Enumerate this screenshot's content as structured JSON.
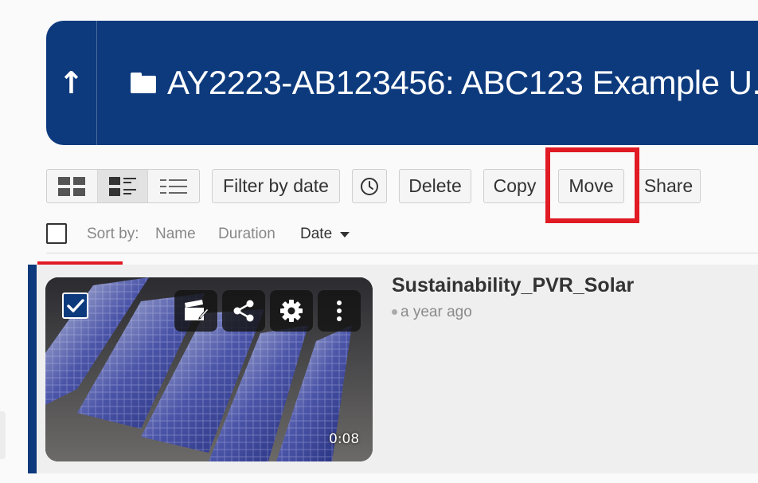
{
  "header": {
    "up_icon": "arrow-up-icon",
    "up_glyph": "↑",
    "folder_icon": "folder-icon",
    "title": "AY2223-AB123456: ABC123 Example U..."
  },
  "toolbar": {
    "view_modes": [
      "grid-view-icon",
      "detail-view-icon",
      "list-view-icon"
    ],
    "filter_label": "Filter by date",
    "clock_icon": "clock-icon",
    "delete_label": "Delete",
    "copy_label": "Copy",
    "move_label": "Move",
    "share_label": "Share"
  },
  "sort": {
    "label": "Sort by:",
    "name": "Name",
    "duration": "Duration",
    "date": "Date"
  },
  "item": {
    "title": "Sustainability_PVR_Solar",
    "meta": "a year ago",
    "duration": "0:08",
    "selected": true,
    "actions": [
      "edit-video-icon",
      "share-icon",
      "settings-gear-icon",
      "more-vertical-icon"
    ]
  },
  "colors": {
    "brand": "#0d3a7d",
    "highlight": "#e01b24"
  }
}
